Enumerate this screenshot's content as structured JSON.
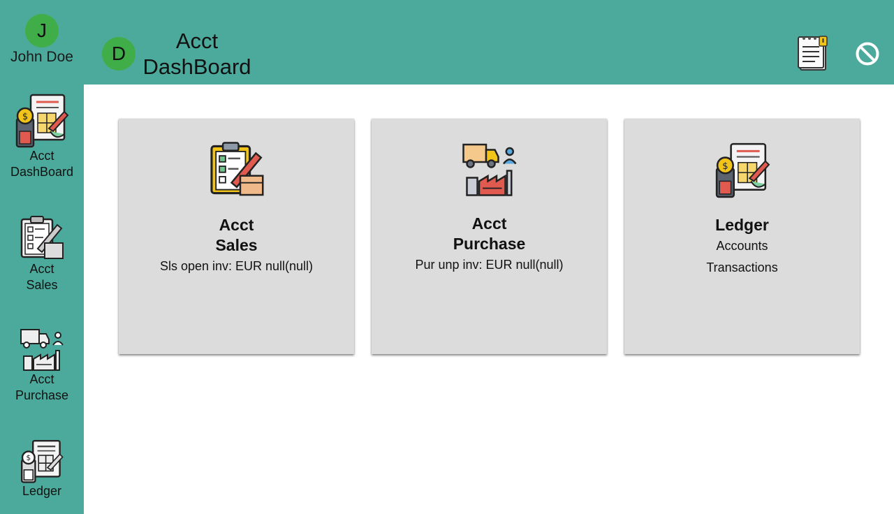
{
  "user": {
    "initial": "J",
    "name": "John Doe"
  },
  "header": {
    "company_initial": "D",
    "title": "Acct\nDashBoard"
  },
  "sidebar": {
    "items": [
      {
        "label": "Acct\nDashBoard",
        "icon": "ledger-calculator-icon"
      },
      {
        "label": "Acct\nSales",
        "icon": "clipboard-sales-icon"
      },
      {
        "label": "Acct\nPurchase",
        "icon": "truck-factory-icon"
      },
      {
        "label": "Ledger",
        "icon": "ledger-calculator-icon"
      }
    ]
  },
  "cards": [
    {
      "title": "Acct\nSales",
      "lines": [
        "Sls open inv: EUR null(null)"
      ],
      "icon": "clipboard-sales-icon"
    },
    {
      "title": "Acct\nPurchase",
      "lines": [
        "Pur unp inv: EUR null(null)"
      ],
      "icon": "truck-factory-icon"
    },
    {
      "title": "Ledger",
      "lines": [
        "Accounts",
        "Transactions"
      ],
      "icon": "ledger-calculator-icon"
    }
  ],
  "colors": {
    "primary": "#4caa9c",
    "avatar": "#3fae49",
    "card": "#dcdcdc"
  }
}
